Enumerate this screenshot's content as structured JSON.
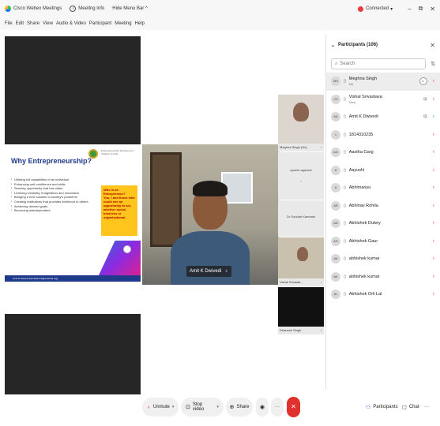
{
  "titlebar": {
    "app_name": "Cisco Webex Meetings",
    "meeting_info": "Meeting Info",
    "hide_menu": "Hide Menu Bar ^",
    "status": "Connected",
    "status_dd": "▾",
    "minimize": "–",
    "restore": "⧉",
    "close": "✕"
  },
  "menu": [
    "File",
    "Edit",
    "Share",
    "View",
    "Audio & Video",
    "Participant",
    "Meeting",
    "Help"
  ],
  "slide": {
    "title": "Why Entrepreneurship?",
    "logo_text": "Entrepreneurship Development Institute of India",
    "bullets": [
      "Utilizing full capabilities of an individual",
      "Enhancing self-confidence and skills",
      "Sensing opportunity that has value",
      "Learning creativity, imagination and innovation",
      "Bringing a new solution to society's problems",
      "Creating institutions that provides livelihood to others",
      "Achieving desired goals",
      "Becoming interdependent"
    ],
    "box_lines": [
      "Who is an",
      "Entrepreneur?",
      "You, I and those who",
      "could see an",
      "opportunity to act,",
      "whether social,",
      "business or",
      "organisational."
    ],
    "footer": "Amit K Dwivedi (amitdwivedi@ediindia.org)"
  },
  "speaker": {
    "name": "Amit K Dwivedi",
    "mic_icon": "♁"
  },
  "thumbnails": [
    {
      "label": "Meghna Singh (Ho)",
      "mic": "♁"
    },
    {
      "label": "",
      "text": "sparsh agarwal",
      "mic": "♁"
    },
    {
      "label": "",
      "text": "Dr Sundari Kanmani",
      "mic": ""
    },
    {
      "label": "Vishal Srivasta...",
      "mic": "♁"
    },
    {
      "label": "Dhanesh Singh",
      "mic": "♁"
    }
  ],
  "panel": {
    "title": "Participants (106)",
    "search_placeholder": "Search",
    "close": "✕",
    "participants": [
      {
        "initials": "MS",
        "name": "Meghna Singh",
        "sub": "Me",
        "cam": "",
        "mic": "off",
        "selected": true,
        "share": true
      },
      {
        "initials": "VS",
        "name": "Vishal Srivastava",
        "sub": "Host",
        "cam": "⊡",
        "mic": "off"
      },
      {
        "initials": "AD",
        "name": "Amit K Dwivedi",
        "sub": "",
        "cam": "⊡",
        "mic": "on"
      },
      {
        "initials": "1",
        "name": "1814310235",
        "sub": "",
        "cam": "",
        "mic": "off"
      },
      {
        "initials": "AG",
        "name": "Aastha Garg",
        "sub": "",
        "cam": "",
        "mic": "off"
      },
      {
        "initials": "A",
        "name": "Aayushi",
        "sub": "",
        "cam": "",
        "mic": "off"
      },
      {
        "initials": "A",
        "name": "Abhimanyu",
        "sub": "",
        "cam": "",
        "mic": "off"
      },
      {
        "initials": "AR",
        "name": "Abhinav Rohila",
        "sub": "",
        "cam": "",
        "mic": "off"
      },
      {
        "initials": "AD",
        "name": "Abhishek Dubey",
        "sub": "",
        "cam": "",
        "mic": "off"
      },
      {
        "initials": "AG",
        "name": "Abhishek Gaur",
        "sub": "",
        "cam": "",
        "mic": "off"
      },
      {
        "initials": "AK",
        "name": "abhishek kumar",
        "sub": "",
        "cam": "",
        "mic": "off"
      },
      {
        "initials": "AK",
        "name": "abhishek kumar",
        "sub": "",
        "cam": "",
        "mic": "off"
      },
      {
        "initials": "AL",
        "name": "Abhishek Orli Lal",
        "sub": "",
        "cam": "",
        "mic": "off"
      }
    ]
  },
  "controls": {
    "unmute": "Unmute",
    "stop_video": "Stop video",
    "share": "Share",
    "participants": "Participants",
    "chat": "Chat",
    "end": "✕",
    "more": "···"
  },
  "colors": {
    "end_call": "#e0312d",
    "mic_muted": "#e33333",
    "mic_on": "#1d9a4b",
    "slide_title": "#1f3a8a",
    "slide_box": "#ffc51d"
  }
}
